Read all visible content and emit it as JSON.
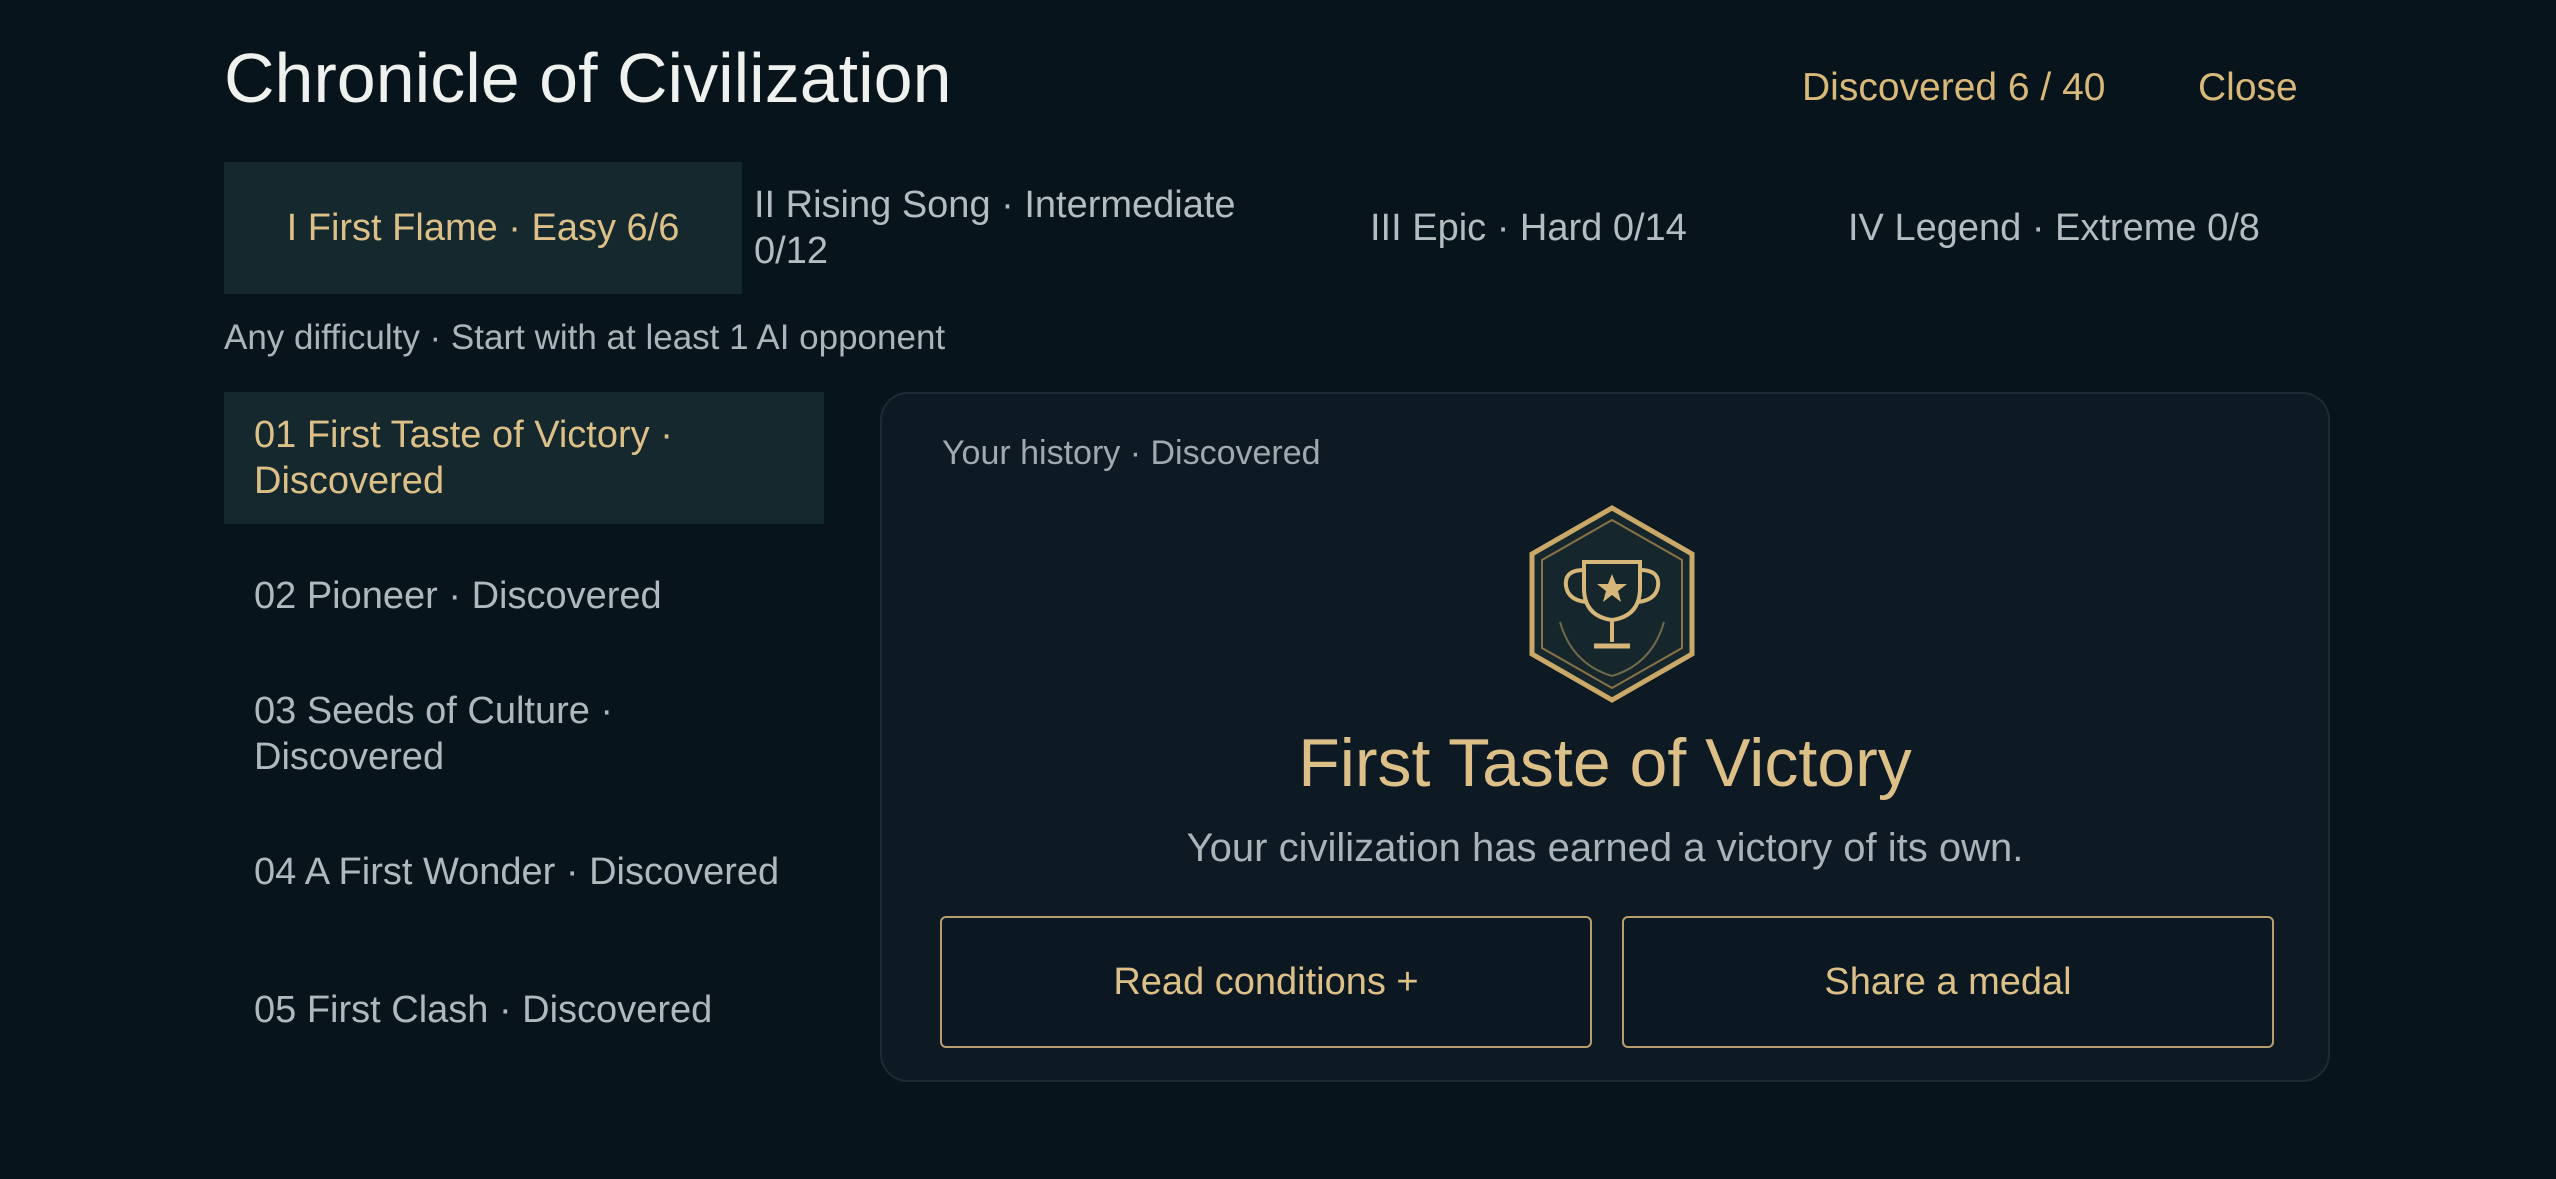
{
  "header": {
    "title": "Chronicle of Civilization",
    "discovered": "Discovered 6 / 40",
    "close_label": "Close"
  },
  "tabs": [
    {
      "label": "I First Flame · Easy  6/6",
      "active": true
    },
    {
      "label": "II Rising Song · Intermediate 0/12",
      "active": false
    },
    {
      "label": "III Epic · Hard  0/14",
      "active": false
    },
    {
      "label": "IV Legend · Extreme  0/8",
      "active": false
    }
  ],
  "subtitle": "Any difficulty · Start with at least 1 AI opponent",
  "achievements": [
    {
      "label": "01  First Taste of Victory · Discovered",
      "active": true
    },
    {
      "label": "02  Pioneer · Discovered",
      "active": false
    },
    {
      "label": "03  Seeds of Culture · Discovered",
      "active": false
    },
    {
      "label": "04  A First Wonder · Discovered",
      "active": false
    },
    {
      "label": "05  First Clash · Discovered",
      "active": false
    }
  ],
  "detail": {
    "label": "Your history · Discovered",
    "medal_icon": "trophy-medal-icon",
    "title": "First Taste of Victory",
    "description": "Your civilization has earned a victory of its own.",
    "read_button": "Read conditions +",
    "share_button": "Share a medal"
  },
  "colors": {
    "background": "#08141b",
    "accent_gold": "#dcc088",
    "active_bg": "#14282e",
    "panel_bg": "#0d1a24"
  }
}
